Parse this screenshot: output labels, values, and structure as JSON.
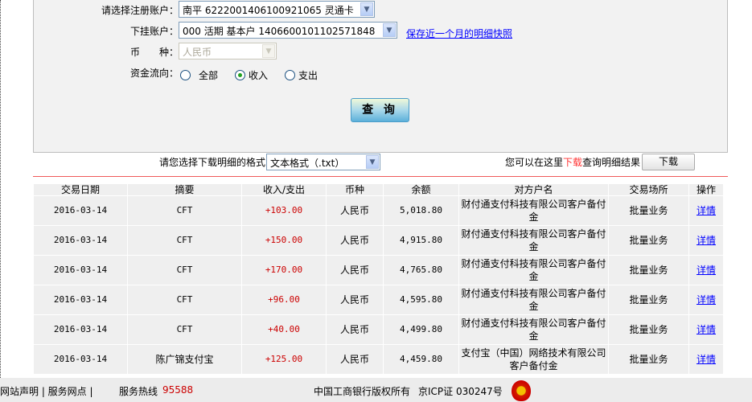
{
  "form": {
    "reg_account_label": "请选择注册账户：",
    "reg_account_value": "南平 6222001406100921065 灵通卡",
    "sub_account_label": "下挂账户：",
    "sub_account_value": "000 活期 基本户 1406600101102571848",
    "save_snapshot_link": "保存近一个月的明细快照",
    "currency_label": "币　　种：",
    "currency_value": "人民币",
    "flow_label": "资金流向：",
    "flow_options": [
      "全部",
      "收入",
      "支出"
    ],
    "flow_selected": "收入",
    "query_button": "查 询"
  },
  "download": {
    "format_label": "请您选择下载明细的格式",
    "format_value": "文本格式（.txt）",
    "hint_prefix": "您可以在这里",
    "hint_link": "下载",
    "hint_suffix": "查询明细结果",
    "button": "下载"
  },
  "table": {
    "headers": [
      "交易日期",
      "摘要",
      "收入/支出",
      "币种",
      "余额",
      "对方户名",
      "交易场所",
      "操作"
    ],
    "rows": [
      [
        "2016-03-14",
        "CFT",
        "+103.00",
        "人民币",
        "5,018.80",
        "财付通支付科技有限公司客户备付金",
        "批量业务",
        "详情"
      ],
      [
        "2016-03-14",
        "CFT",
        "+150.00",
        "人民币",
        "4,915.80",
        "财付通支付科技有限公司客户备付金",
        "批量业务",
        "详情"
      ],
      [
        "2016-03-14",
        "CFT",
        "+170.00",
        "人民币",
        "4,765.80",
        "财付通支付科技有限公司客户备付金",
        "批量业务",
        "详情"
      ],
      [
        "2016-03-14",
        "CFT",
        "+96.00",
        "人民币",
        "4,595.80",
        "财付通支付科技有限公司客户备付金",
        "批量业务",
        "详情"
      ],
      [
        "2016-03-14",
        "CFT",
        "+40.00",
        "人民币",
        "4,499.80",
        "财付通支付科技有限公司客户备付金",
        "批量业务",
        "详情"
      ],
      [
        "2016-03-14",
        "陈广锦支付宝",
        "+125.00",
        "人民币",
        "4,459.80",
        "支付宝（中国）网络技术有限公司客户备付金",
        "批量业务",
        "详情"
      ]
    ]
  },
  "footer": {
    "links": "网站声明 | 服务网点 |",
    "hotline_label": "服务热线",
    "hotline": "95588",
    "copyright": "中国工商银行版权所有",
    "icp": "京ICP证 030247号"
  },
  "colors": {
    "amount": "#cc0000",
    "link": "#0000ff",
    "download_highlight": "#ff3333",
    "divider": "#f05a5a"
  }
}
